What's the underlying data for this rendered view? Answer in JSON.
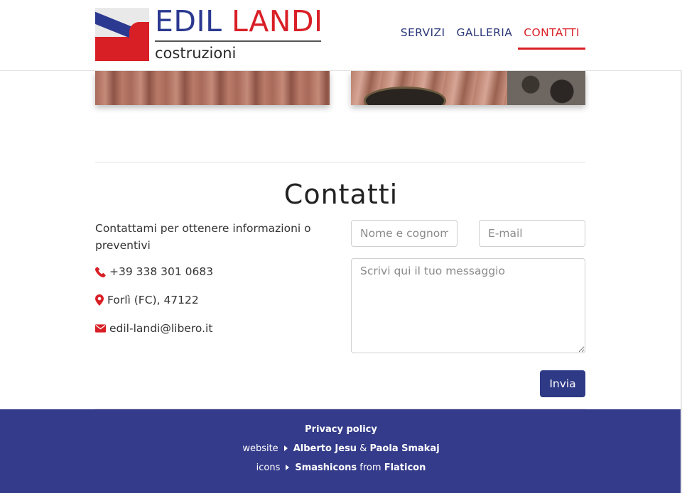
{
  "brand": {
    "name_part1": "EDIL",
    "name_part2": "LANDI",
    "subtitle": "costruzioni",
    "colors": {
      "blue": "#2b3990",
      "red": "#d91f26"
    }
  },
  "nav": {
    "items": [
      {
        "label": "SERVIZI",
        "active": false
      },
      {
        "label": "GALLERIA",
        "active": false
      },
      {
        "label": "CONTATTI",
        "active": true
      }
    ]
  },
  "contact": {
    "title": "Contatti",
    "intro": "Contattami per ottenere informazioni o preventivi",
    "phone": "+39 338 301 0683",
    "address": "Forlì (FC), 47122",
    "email": "edil-landi@libero.it",
    "icons": {
      "phone": "phone-icon",
      "address": "map-marker-icon",
      "email": "envelope-icon"
    }
  },
  "form": {
    "name_placeholder": "Nome e cognome",
    "email_placeholder": "E-mail",
    "message_placeholder": "Scrivi qui il tuo messaggio",
    "submit_label": "Invia"
  },
  "footer": {
    "privacy": "Privacy policy",
    "website_label": "website",
    "author1": "Alberto Jesu",
    "and": "&",
    "author2": "Paola Smakaj",
    "icons_label": "icons",
    "icons_author": "Smashicons",
    "from": "from",
    "icons_source": "Flaticon",
    "bg_color": "#343b8a"
  }
}
